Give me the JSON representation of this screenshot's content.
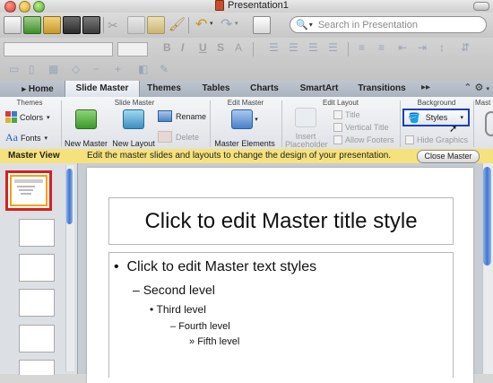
{
  "window": {
    "title": "Presentation1"
  },
  "search": {
    "placeholder": "Search in Presentation"
  },
  "tabs": [
    {
      "label": "Home"
    },
    {
      "label": "Slide Master"
    },
    {
      "label": "Themes"
    },
    {
      "label": "Tables"
    },
    {
      "label": "Charts"
    },
    {
      "label": "SmartArt"
    },
    {
      "label": "Transitions"
    }
  ],
  "ribbon": {
    "themes": {
      "title": "Themes",
      "colors": "Colors",
      "fonts": "Fonts"
    },
    "slide_master": {
      "title": "Slide Master",
      "new_master": "New Master",
      "new_layout": "New Layout",
      "rename": "Rename",
      "delete": "Delete"
    },
    "edit_master": {
      "title": "Edit Master",
      "master_elements": "Master Elements"
    },
    "edit_layout": {
      "title": "Edit Layout",
      "insert_placeholder": "Insert Placeholder",
      "title_chk": "Title",
      "vertical_title": "Vertical Title",
      "allow_footers": "Allow Footers"
    },
    "background": {
      "title": "Background",
      "styles": "Styles",
      "hide_graphics": "Hide Graphics"
    },
    "overflow_title": "Mast"
  },
  "master_bar": {
    "title": "Master View",
    "description": "Edit the master slides and layouts to change the design of your presentation.",
    "close": "Close Master"
  },
  "slide": {
    "title": "Click to edit Master title style",
    "levels": [
      "Click to edit Master text styles",
      "Second level",
      "Third level",
      "Fourth level",
      "Fifth level"
    ]
  },
  "colors": {
    "highlight_border": "#1b3fbf",
    "selected_thumb": "#d61f1f",
    "master_bar": "#f6e27c"
  }
}
